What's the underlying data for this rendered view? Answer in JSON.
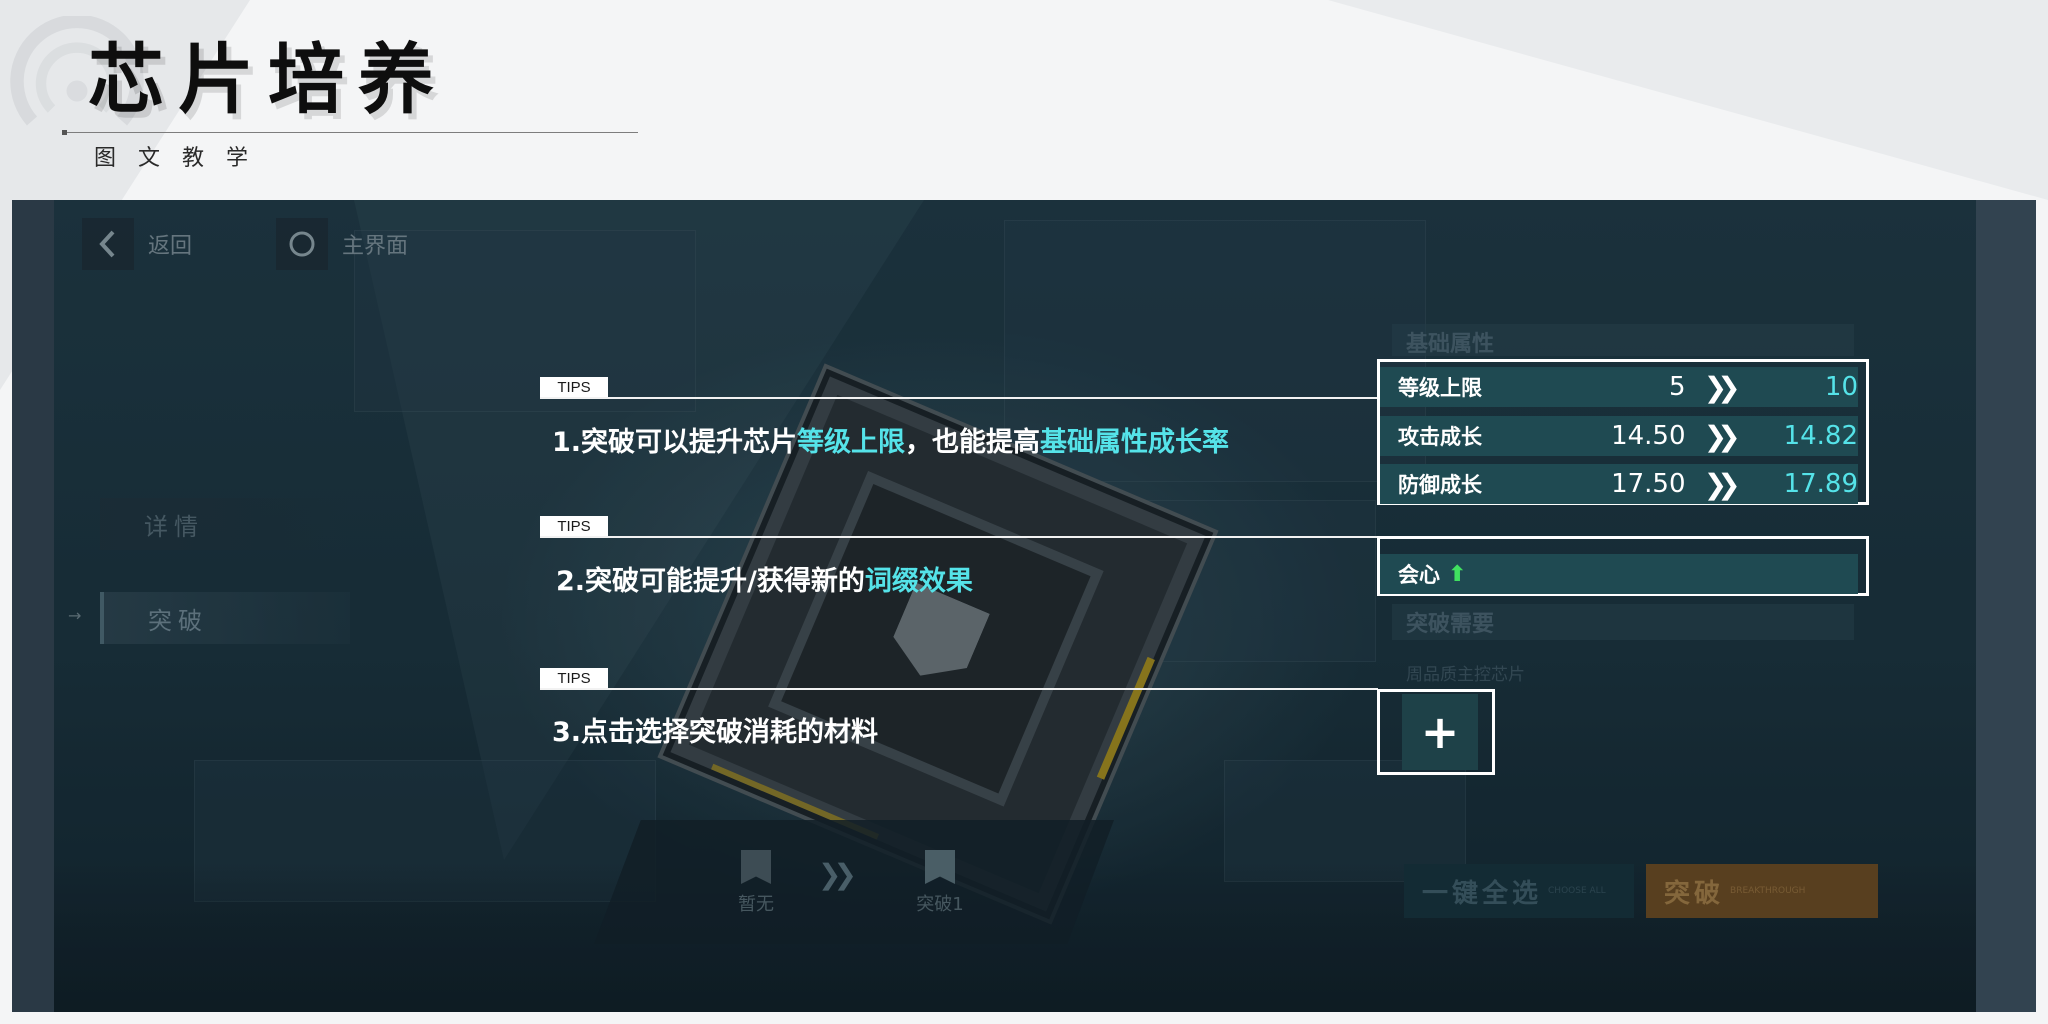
{
  "slide": {
    "title": "芯片培养",
    "subtitle": "图文教学"
  },
  "game": {
    "nav": {
      "back_label": "返回",
      "home_label": "主界面"
    },
    "side_tabs": [
      {
        "label": "详情",
        "active": false
      },
      {
        "label": "突破",
        "active": true
      }
    ],
    "sections": {
      "base_attr_header": "基础属性",
      "break_need_header": "突破需要",
      "material_caption": "周品质主控芯片"
    },
    "stats": [
      {
        "name": "等级上限",
        "from": "5",
        "to": "10"
      },
      {
        "name": "攻击成长",
        "from": "14.50",
        "to": "14.82"
      },
      {
        "name": "防御成长",
        "from": "17.50",
        "to": "17.89"
      }
    ],
    "affix": {
      "name": "会心",
      "indicator": "up-arrow-icon"
    },
    "plus_glyph": "+",
    "pedestal": {
      "left_label": "暂无",
      "right_label": "突破1"
    },
    "buttons": {
      "select_all": {
        "label": "一键全选",
        "sub": "CHOOSE ALL"
      },
      "breakthrough": {
        "label": "突破",
        "sub": "BREAKTHROUGH"
      }
    },
    "colors": {
      "highlight": "#55e3e9",
      "stat_row": "#1f4a52",
      "break_button": "#b36a1e"
    }
  },
  "tips": [
    {
      "tag": "TIPS",
      "parts": [
        "1.突破可以提升芯片",
        "等级上限",
        "，也能提高",
        "基础属性成长率"
      ]
    },
    {
      "tag": "TIPS",
      "parts": [
        "2.突破可能提升/获得新的",
        "词缀效果"
      ]
    },
    {
      "tag": "TIPS",
      "parts": [
        "3.点击选择突破消耗的材料"
      ]
    }
  ]
}
